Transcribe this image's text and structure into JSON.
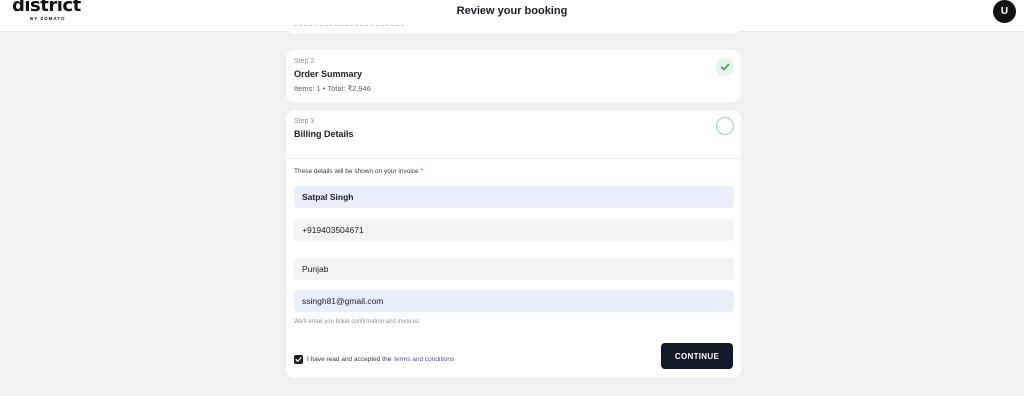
{
  "header": {
    "logo_text": "district",
    "logo_subtext": "BY ZOMATO",
    "title": "Review your booking",
    "avatar_initial": "U"
  },
  "steps": [
    {
      "label": "Step 2",
      "title": "Order Summary",
      "summary": "Items: 1 • Total: ₹2,946",
      "status": "complete"
    },
    {
      "label": "Step 3",
      "title": "Billing Details",
      "status": "active"
    }
  ],
  "billing": {
    "hint": "These details will be shown on your invoice",
    "required_mark": "*",
    "fields": [
      {
        "name": "full-name",
        "value": "Satpal Singh"
      },
      {
        "name": "phone",
        "value": "+919403504671"
      },
      {
        "name": "state",
        "value": "Punjab"
      },
      {
        "name": "email",
        "value": "ssingh81@gmail.com"
      }
    ],
    "email_note": "We'll email you ticket confirmation and invoices",
    "terms_prefix": "I have read and accepted the",
    "terms_link": "terms and conditions",
    "terms_checked": true,
    "continue_label": "CONTINUE"
  },
  "colors": {
    "accent_dark": "#111827",
    "success": "#2e9e4f",
    "field_filled": "#e8effb"
  }
}
